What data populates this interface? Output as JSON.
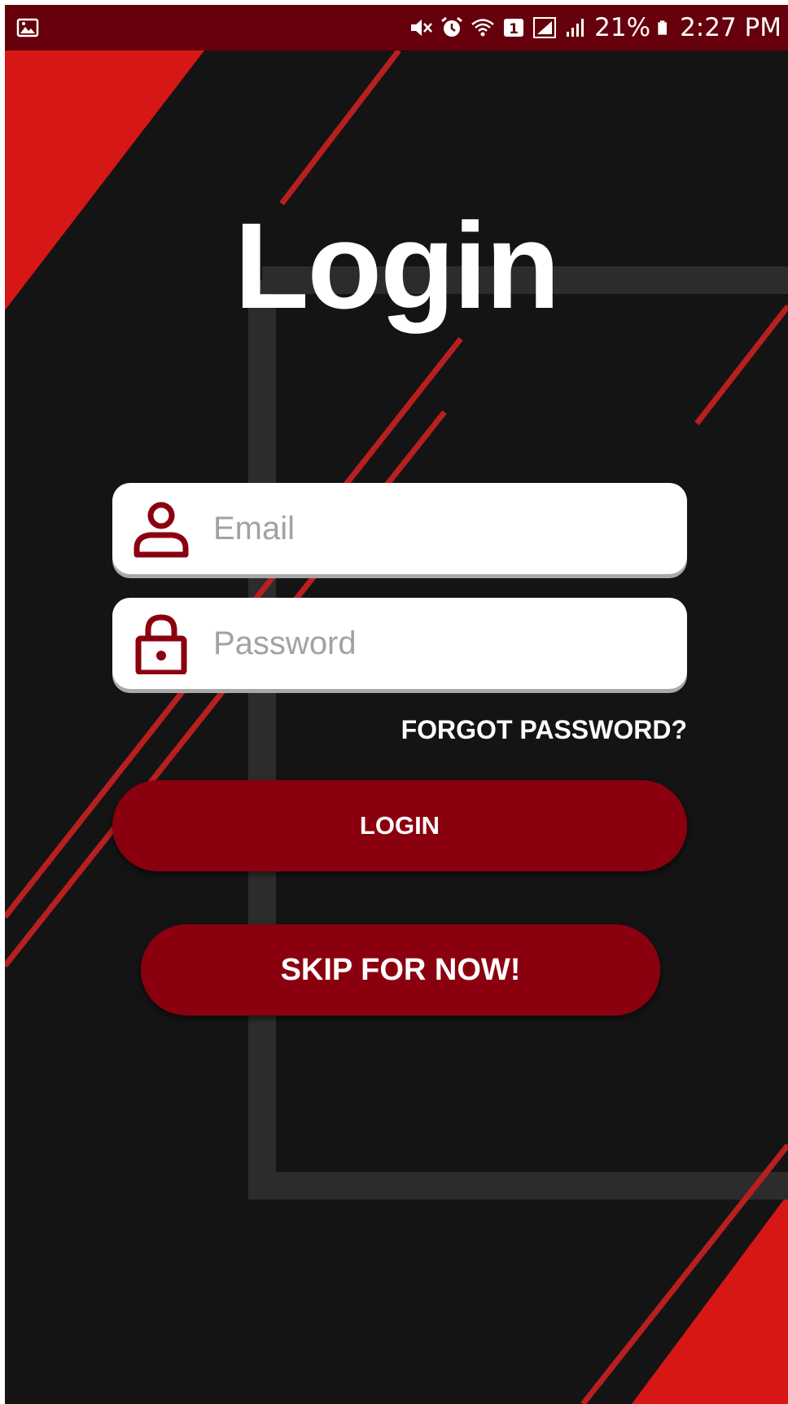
{
  "status_bar": {
    "battery_percent": "21%",
    "time": "2:27 PM",
    "icons": [
      "gallery-icon",
      "mute-icon",
      "alarm-icon",
      "wifi-icon",
      "sim-1-icon",
      "signal-bars-icon",
      "signal-bars-icon",
      "battery-icon"
    ]
  },
  "title": "Login",
  "email": {
    "placeholder": "Email",
    "value": "",
    "icon": "person-icon"
  },
  "password": {
    "placeholder": "Password",
    "value": "",
    "icon": "lock-icon"
  },
  "forgot_password": "FORGOT PASSWORD?",
  "login_button": "LOGIN",
  "skip_button": "SKIP FOR NOW!",
  "colors": {
    "status_bar": "#66000c",
    "background": "#141414",
    "accent_red": "#d71616",
    "button": "#8b000f",
    "icon": "#8b000f"
  }
}
